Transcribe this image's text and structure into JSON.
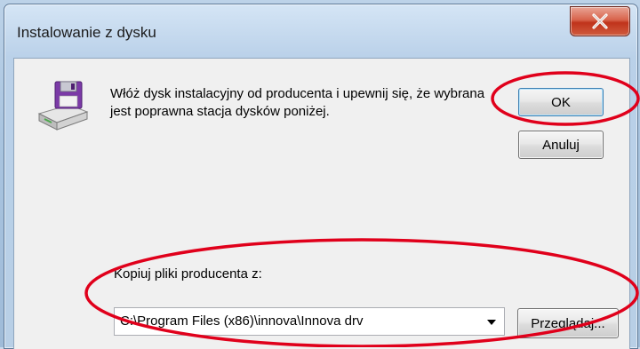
{
  "window": {
    "title": "Instalowanie z dysku"
  },
  "message": {
    "text": "Włóż dysk instalacyjny od producenta i upewnij się, że wybrana jest poprawna stacja dysków poniżej."
  },
  "buttons": {
    "ok": "OK",
    "cancel": "Anuluj",
    "browse": "Przeglądaj..."
  },
  "copy_from": {
    "label": "Kopiuj pliki producenta z:",
    "value": "C:\\Program Files (x86)\\innova\\Innova drv"
  },
  "icons": {
    "disk": "floppy-disk-drive-icon",
    "close": "close-icon",
    "dropdown": "chevron-down-icon"
  },
  "colors": {
    "annotation": "#e0001b",
    "close_button": "#c0331b"
  }
}
